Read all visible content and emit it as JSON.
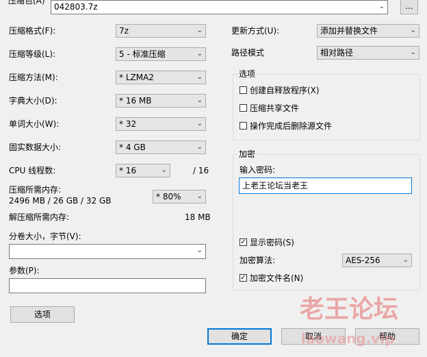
{
  "archive": {
    "label": "压缩包(A)",
    "filename": "042803.7z",
    "browse": "..."
  },
  "left": {
    "format_label": "压缩格式(F):",
    "format_value": "7z",
    "level_label": "压缩等级(L):",
    "level_value": "5 - 标准压缩",
    "method_label": "压缩方法(M):",
    "method_value": "* LZMA2",
    "dict_label": "字典大小(D):",
    "dict_value": "* 16 MB",
    "word_label": "单词大小(W):",
    "word_value": "* 32",
    "solid_label": "固实数据大小:",
    "solid_value": "* 4 GB",
    "cpu_label": "CPU 线程数:",
    "cpu_value": "* 16",
    "cpu_total": "/ 16",
    "mem_label": "压缩所需内存:",
    "mem_detail": "2496 MB / 26 GB / 32 GB",
    "mem_value": "* 80%",
    "decomp_label": "解压缩所需内存:",
    "decomp_value": "18 MB",
    "split_label": "分卷大小，字节(V):",
    "split_value": "",
    "params_label": "参数(P):",
    "params_value": "",
    "options_button": "选项"
  },
  "right": {
    "update_label": "更新方式(U):",
    "update_value": "添加并替换文件",
    "path_label": "路径模式",
    "path_value": "相对路径",
    "options_group": "选项",
    "opt_sfx": "创建自释放程序(X)",
    "opt_shared": "压缩共享文件",
    "opt_delete": "操作完成后删除源文件",
    "encrypt_group": "加密",
    "password_label": "输入密码:",
    "password_value": "上老王论坛当老王",
    "show_password": "显示密码(S)",
    "algo_label": "加密算法:",
    "algo_value": "AES-256",
    "encrypt_names": "加密文件名(N)"
  },
  "buttons": {
    "ok": "确定",
    "cancel": "取消",
    "help": "帮助"
  },
  "checks": {
    "opt_sfx": false,
    "opt_shared": false,
    "opt_delete": false,
    "show_password": true,
    "encrypt_names": true
  },
  "watermark": {
    "cn": "老王论坛",
    "url": "laowang.vip"
  }
}
